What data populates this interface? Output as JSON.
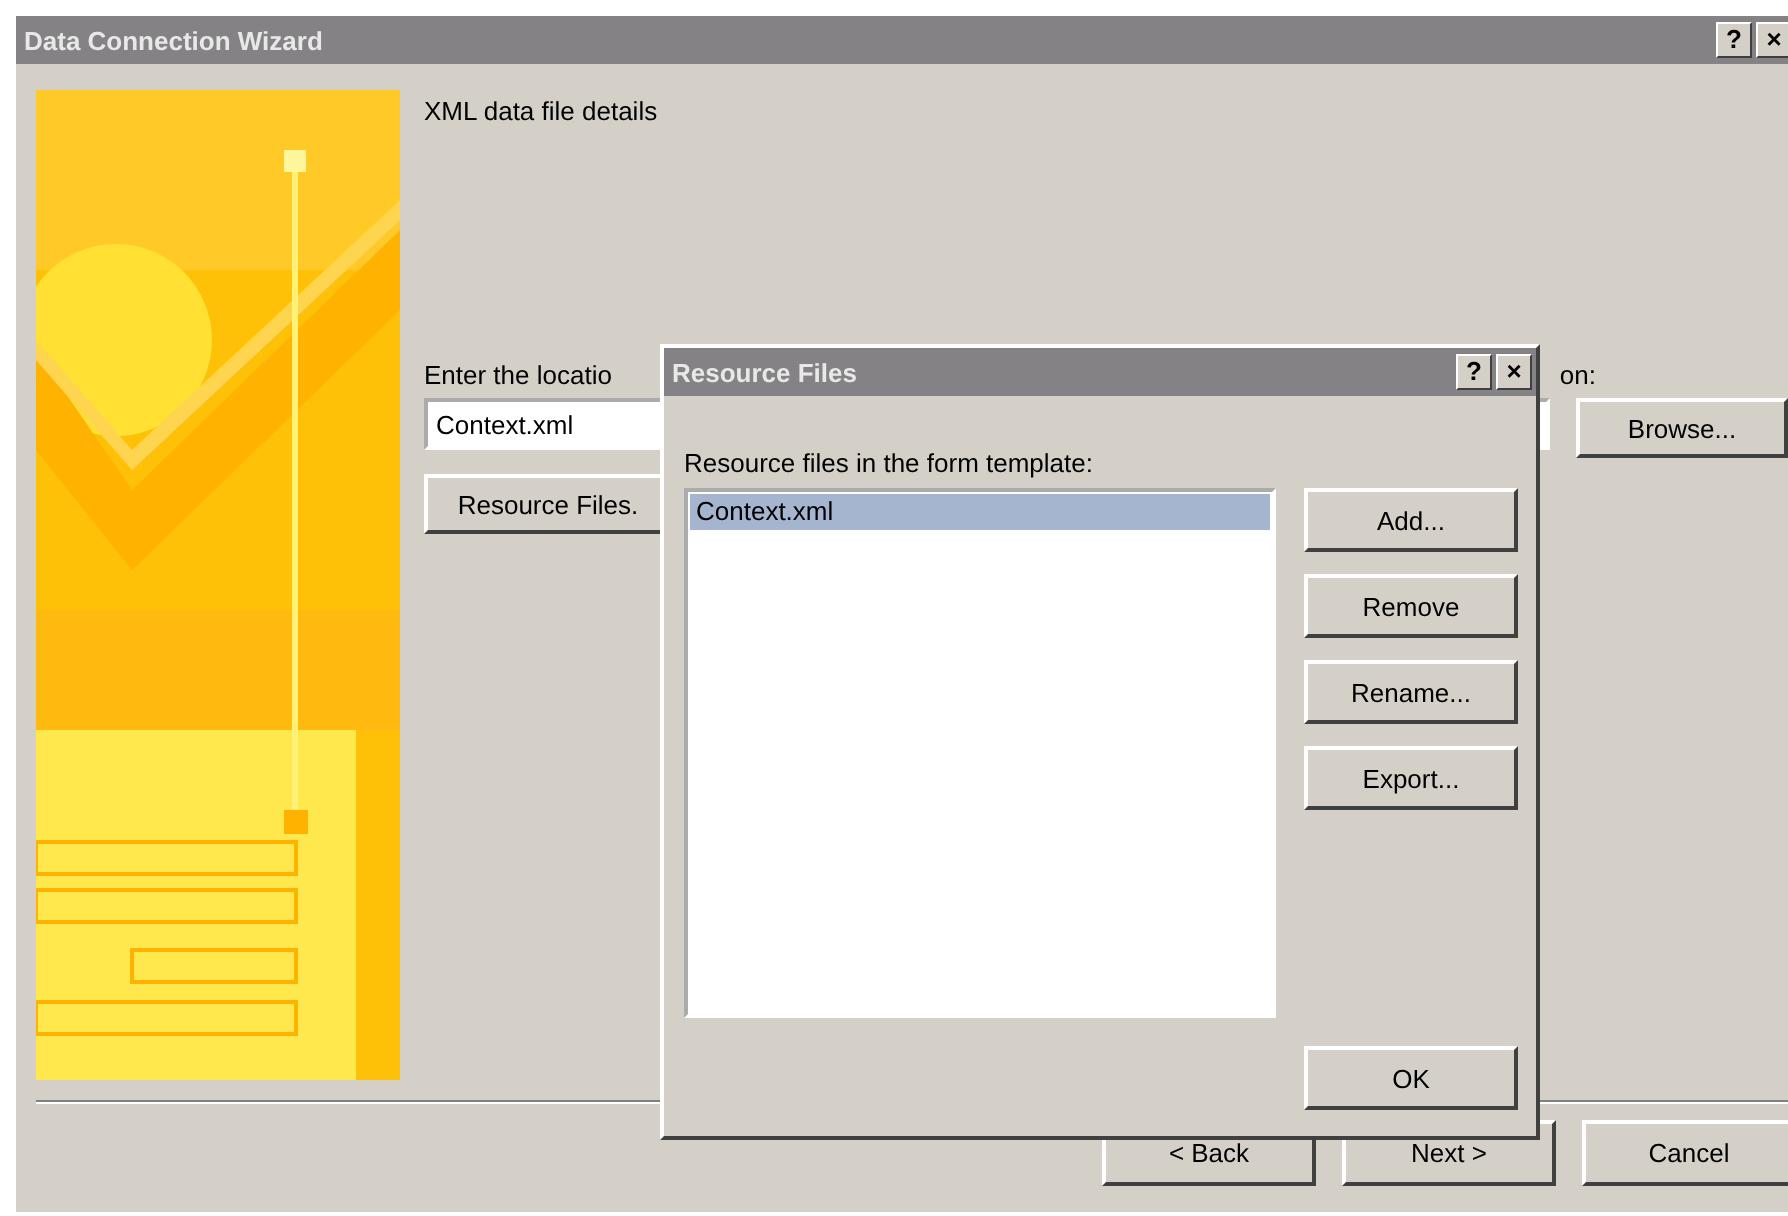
{
  "window": {
    "title": "Data Connection Wizard",
    "title_buttons": [
      "?",
      "×"
    ]
  },
  "heading": "XML data file details",
  "location_label": {
    "start": "Enter the locatio",
    "end": "on:"
  },
  "location_field": {
    "value": "Context.xml"
  },
  "browse_button": "Browse...",
  "resource_button": "Resource Files.",
  "footer_buttons": [
    "< Back",
    "Next >",
    "Cancel"
  ],
  "dialog": {
    "title": "Resource Files",
    "title_buttons": [
      "?",
      "×"
    ],
    "list_label": "Resource files in the form template:",
    "files": [
      {
        "name": "Context.xml",
        "selected": true
      }
    ],
    "side_buttons": [
      "Add...",
      "Remove",
      "Rename...",
      "Export..."
    ],
    "ok_button": "OK"
  }
}
